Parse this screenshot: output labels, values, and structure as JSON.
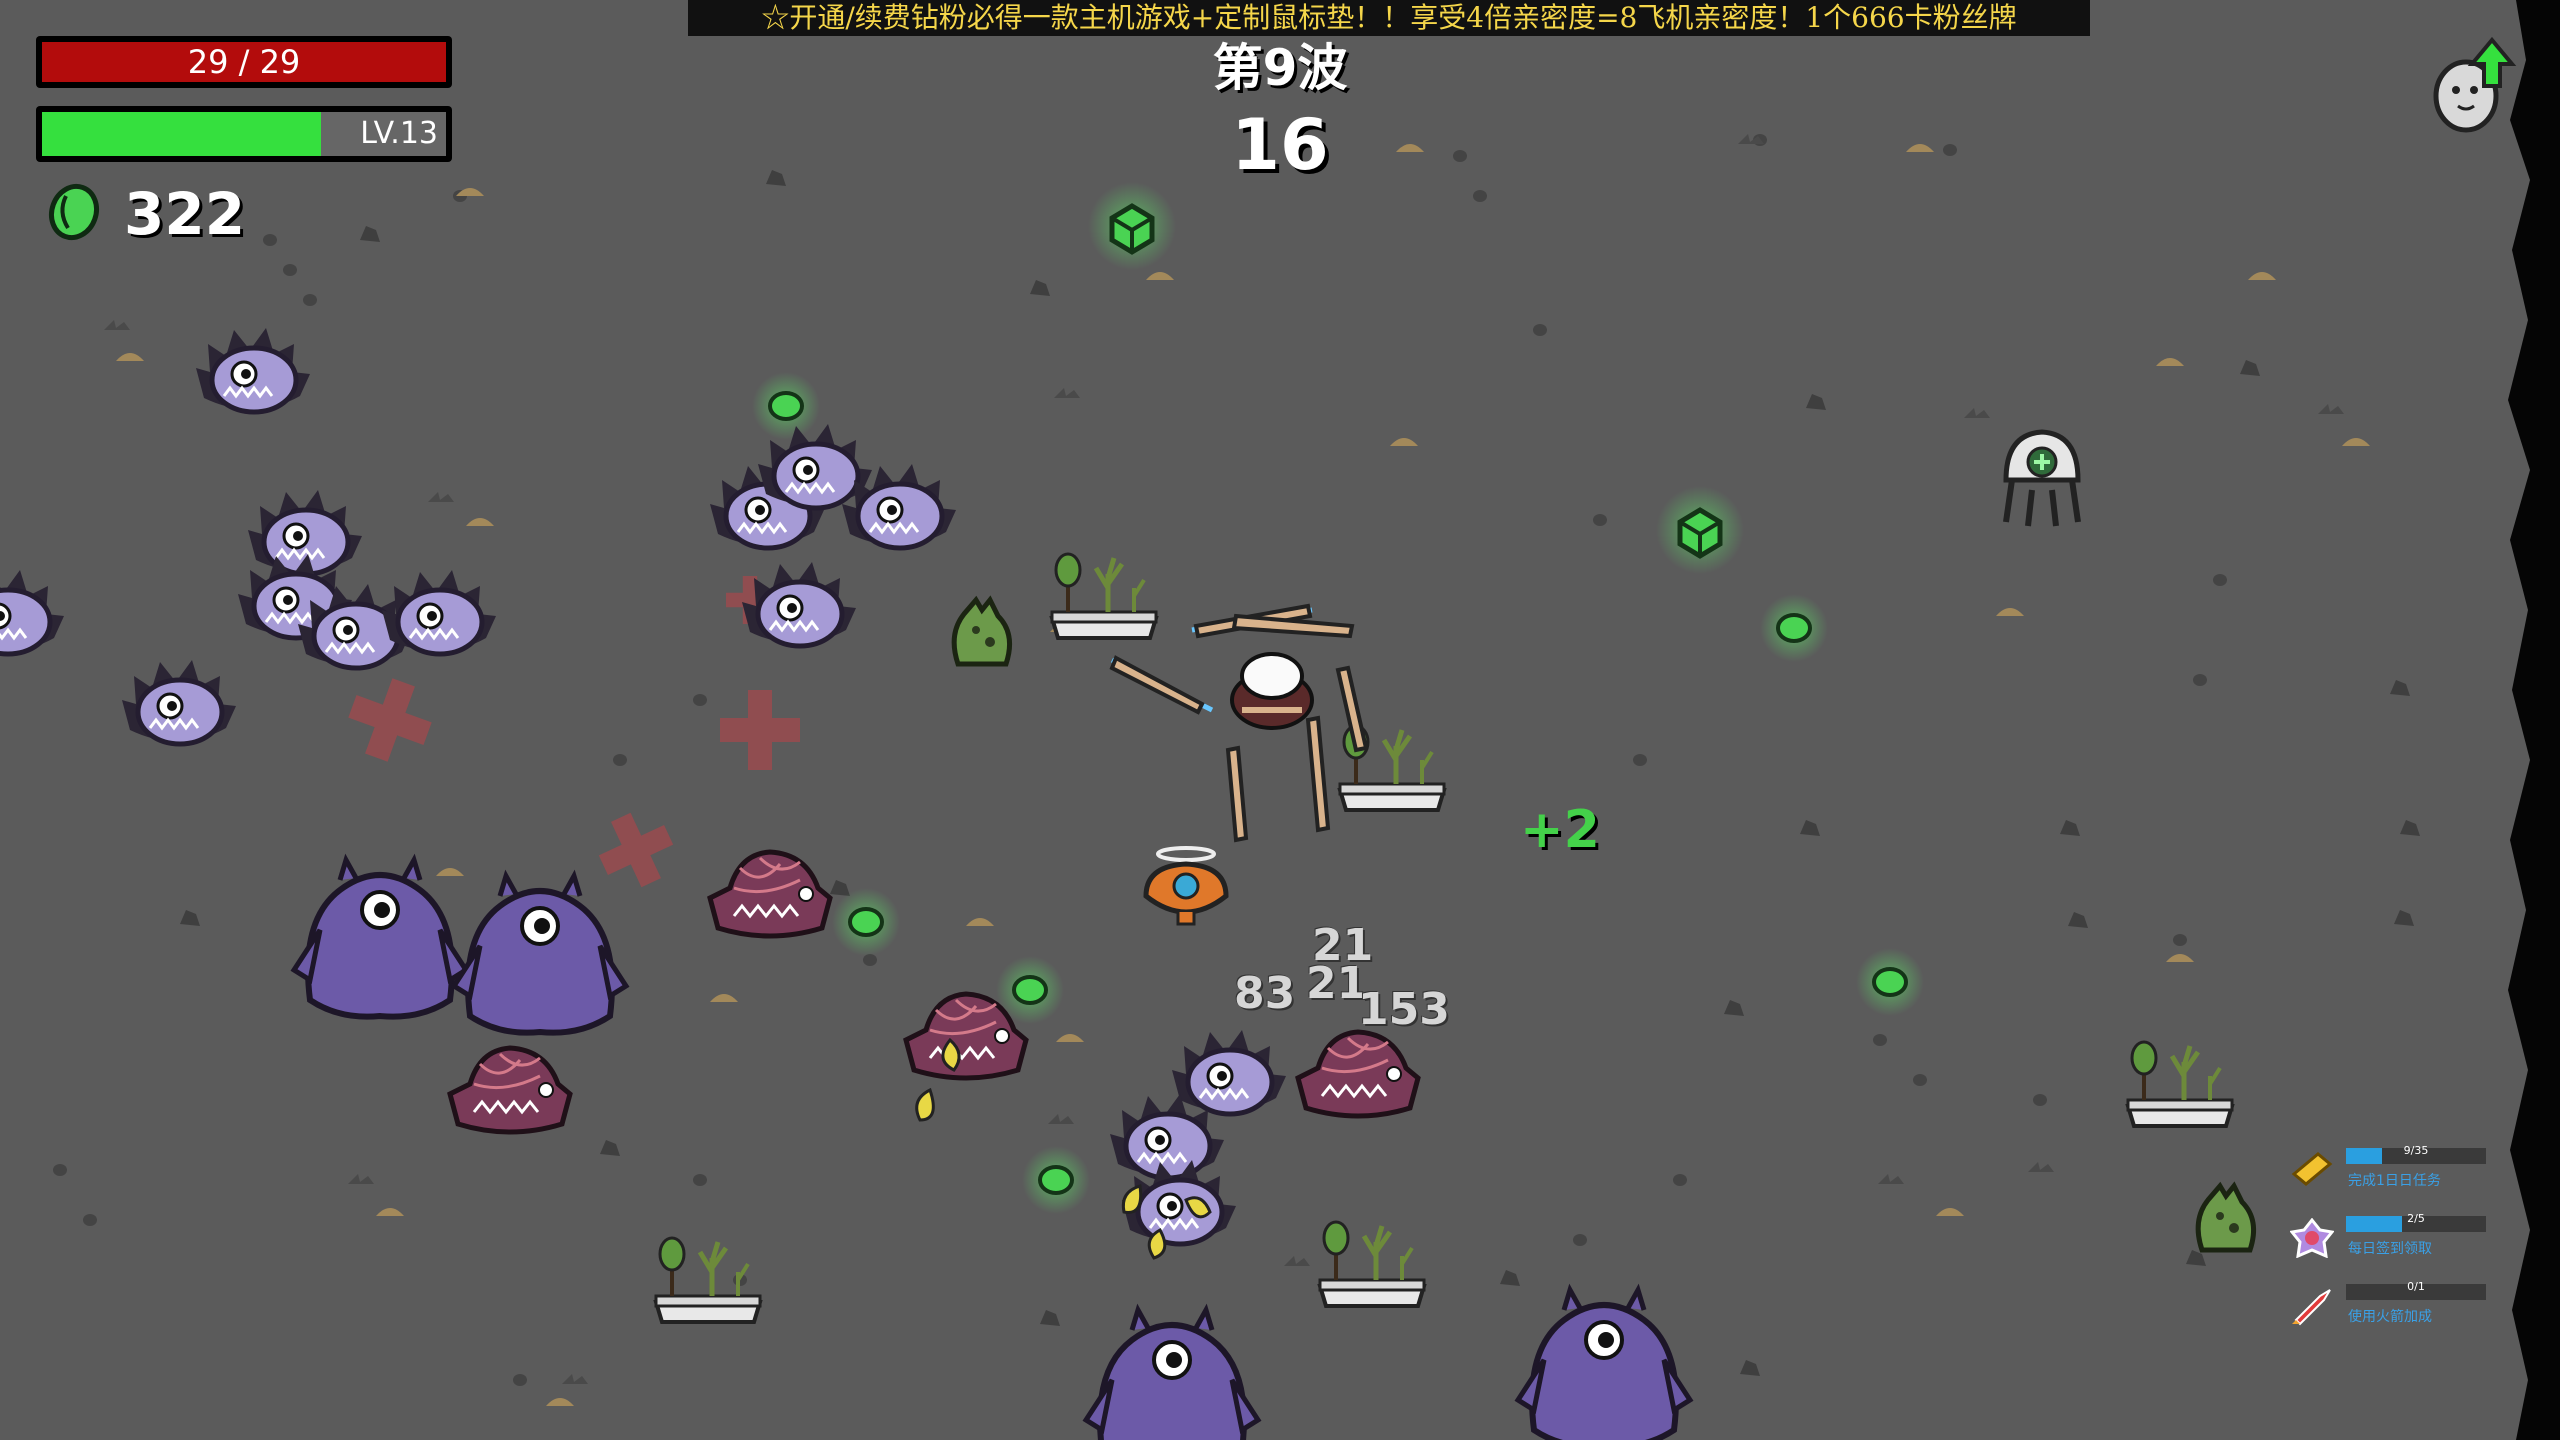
{
  "hud": {
    "hp_text": "29 / 29",
    "hp_fraction": 1.0,
    "level_text": "LV.13",
    "xp_fraction": 0.69,
    "materials_count": "322"
  },
  "banner": {
    "text": "☆开通/续费钻粉必得一款主机游戏+定制鼠标垫！！享受4倍亲密度=8飞机亲密度！1个666卡粉丝牌"
  },
  "wave": {
    "title": "第9波",
    "timer": "16"
  },
  "combat_text": {
    "damage_numbers": [
      "21",
      "21",
      "83",
      "153"
    ],
    "heal_popup": "+2"
  },
  "tasks": [
    {
      "progress_text": "9/35",
      "progress": 0.26,
      "label": "完成1日日任务",
      "icon": "gold-ticket-icon"
    },
    {
      "progress_text": "2/5",
      "progress": 0.4,
      "label": "每日签到领取",
      "icon": "purple-badge-icon"
    },
    {
      "progress_text": "0/1",
      "progress": 0.0,
      "label": "使用火箭加成",
      "icon": "rocket-icon"
    }
  ],
  "colors": {
    "ground": "#5b5b5b",
    "hp_red": "#b30c0c",
    "xp_green": "#35e03e",
    "material_green": "#4ad353",
    "enemy_purple": "#8a7cc4",
    "banner_yellow": "#f5d64a"
  }
}
